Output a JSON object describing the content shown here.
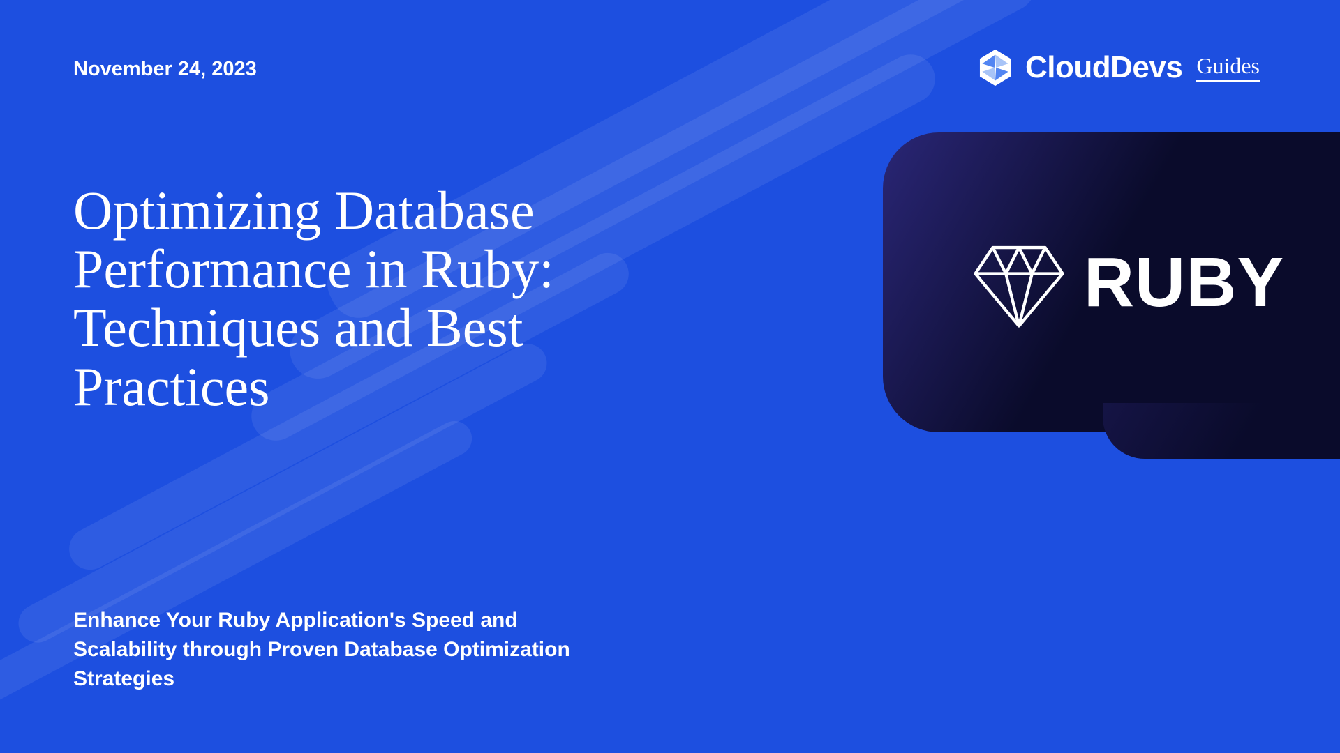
{
  "date": "November 24, 2023",
  "brand": {
    "name": "CloudDevs",
    "sub": "Guides"
  },
  "title": "Optimizing Database Performance in Ruby: Techniques and Best Practices",
  "subtitle": "Enhance Your Ruby Application's Speed and Scalability through Proven Database Optimization Strategies",
  "tech_badge": {
    "label": "RUBY",
    "icon": "ruby-gem-icon"
  }
}
